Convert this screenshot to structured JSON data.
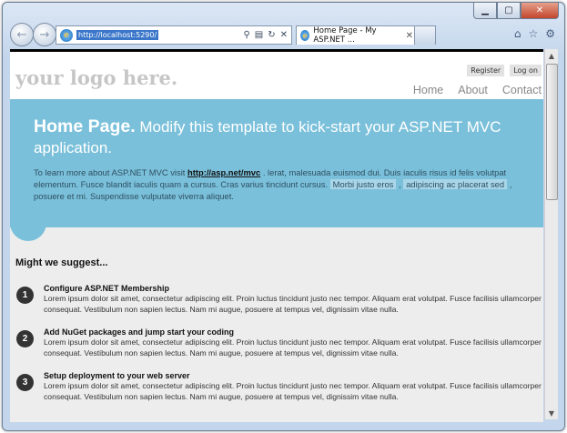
{
  "browser": {
    "address_url": "http://localhost:5290/",
    "tab_title": "Home Page - My ASP.NET ...",
    "nav_back": "←",
    "nav_forward": "→"
  },
  "site": {
    "logo": "your logo here.",
    "login_links": [
      "Register",
      "Log on"
    ],
    "menu": [
      "Home",
      "About",
      "Contact"
    ]
  },
  "featured": {
    "title_bold": "Home Page.",
    "title_rest": " Modify this template to kick-start your ASP.NET MVC application.",
    "intro_1": "To learn more about ASP.NET MVC visit ",
    "link": "http://asp.net/mvc",
    "intro_2": " . lerat, malesuada euismod dui. Duis iaculis risus id felis volutpat elementum. Fusce blandit iaculis quam a cursus. Cras varius tincidunt cursus. ",
    "hl1": "Morbi justo eros",
    "sep": " , ",
    "hl2": "adipiscing ac placerat sed",
    "intro_3": " , posuere et mi. Suspendisse vulputate viverra aliquet."
  },
  "main": {
    "heading": "Might we suggest...",
    "steps": [
      {
        "num": "1",
        "title": "Configure ASP.NET Membership",
        "text": "Lorem ipsum dolor sit amet, consectetur adipiscing elit. Proin luctus tincidunt justo nec tempor. Aliquam erat volutpat. Fusce facilisis ullamcorper consequat. Vestibulum non sapien lectus. Nam mi augue, posuere at tempus vel, dignissim vitae nulla."
      },
      {
        "num": "2",
        "title": "Add NuGet packages and jump start your coding",
        "text": "Lorem ipsum dolor sit amet, consectetur adipiscing elit. Proin luctus tincidunt justo nec tempor. Aliquam erat volutpat. Fusce facilisis ullamcorper consequat. Vestibulum non sapien lectus. Nam mi augue, posuere at tempus vel, dignissim vitae nulla."
      },
      {
        "num": "3",
        "title": "Setup deployment to your web server",
        "text": "Lorem ipsum dolor sit amet, consectetur adipiscing elit. Proin luctus tincidunt justo nec tempor. Aliquam erat volutpat. Fusce facilisis ullamcorper consequat. Vestibulum non sapien lectus. Nam mi augue, posuere at tempus vel, dignissim vitae nulla."
      }
    ]
  }
}
